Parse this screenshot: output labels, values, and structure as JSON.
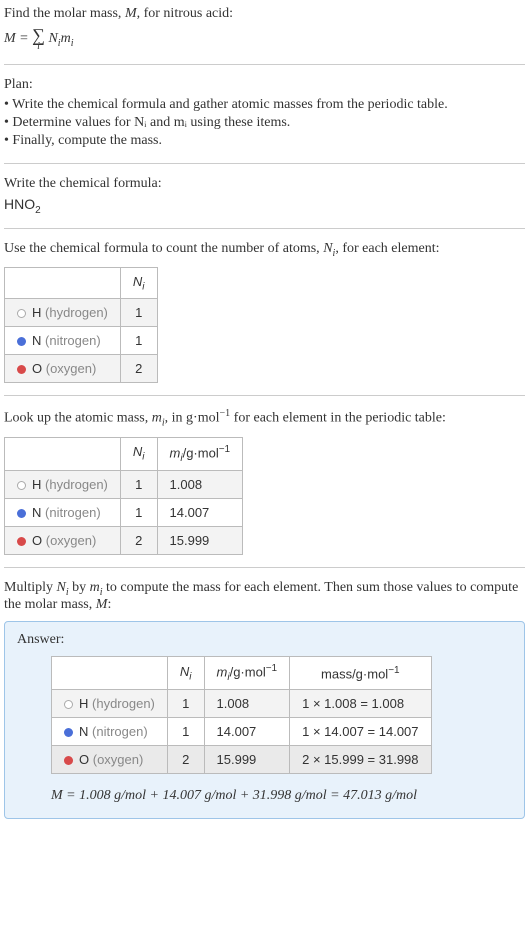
{
  "intro": {
    "line1": "Find the molar mass, ",
    "Mvar": "M",
    "line1b": ", for nitrous acid:",
    "eq_lhs": "M = ",
    "sigma": "∑",
    "sigma_under": "i",
    "eq_rhs": " N",
    "eq_i1": "i",
    "eq_m": "m",
    "eq_i2": "i"
  },
  "plan": {
    "title": "Plan:",
    "items": [
      "• Write the chemical formula and gather atomic masses from the periodic table.",
      "• Determine values for Nᵢ and mᵢ using these items.",
      "• Finally, compute the mass."
    ]
  },
  "writeFormula": {
    "title": "Write the chemical formula:",
    "formula_base": "HNO",
    "formula_sub": "2"
  },
  "countAtoms": {
    "title_a": "Use the chemical formula to count the number of atoms, ",
    "Nvar": "N",
    "Nsub": "i",
    "title_b": ", for each element:",
    "hdr_N": "N",
    "hdr_Nsub": "i",
    "rows": [
      {
        "dot": "dot-h",
        "sym": "H",
        "name": "(hydrogen)",
        "N": "1"
      },
      {
        "dot": "dot-n",
        "sym": "N",
        "name": "(nitrogen)",
        "N": "1"
      },
      {
        "dot": "dot-o",
        "sym": "O",
        "name": "(oxygen)",
        "N": "2"
      }
    ]
  },
  "lookup": {
    "title_a": "Look up the atomic mass, ",
    "mvar": "m",
    "msub": "i",
    "title_b": ", in g·mol",
    "title_sup": "−1",
    "title_c": " for each element in the periodic table:",
    "hdr_m": "m",
    "hdr_msub": "i",
    "hdr_unit": "/g·mol",
    "hdr_unit_sup": "−1",
    "rows": [
      {
        "dot": "dot-h",
        "sym": "H",
        "name": "(hydrogen)",
        "N": "1",
        "m": "1.008"
      },
      {
        "dot": "dot-n",
        "sym": "N",
        "name": "(nitrogen)",
        "N": "1",
        "m": "14.007"
      },
      {
        "dot": "dot-o",
        "sym": "O",
        "name": "(oxygen)",
        "N": "2",
        "m": "15.999"
      }
    ]
  },
  "multiply": {
    "title_a": "Multiply ",
    "N": "N",
    "Nsub": "i",
    "title_b": " by ",
    "m": "m",
    "msub": "i",
    "title_c": " to compute the mass for each element. Then sum those values to compute the molar mass, ",
    "Mvar": "M",
    "title_d": ":"
  },
  "answer": {
    "title": "Answer:",
    "hdr_mass": "mass/g·mol",
    "hdr_mass_sup": "−1",
    "rows": [
      {
        "dot": "dot-h",
        "sym": "H",
        "name": "(hydrogen)",
        "N": "1",
        "m": "1.008",
        "mass": "1 × 1.008 = 1.008"
      },
      {
        "dot": "dot-n",
        "sym": "N",
        "name": "(nitrogen)",
        "N": "1",
        "m": "14.007",
        "mass": "1 × 14.007 = 14.007"
      },
      {
        "dot": "dot-o",
        "sym": "O",
        "name": "(oxygen)",
        "N": "2",
        "m": "15.999",
        "mass": "2 × 15.999 = 31.998"
      }
    ],
    "final": "M = 1.008 g/mol + 14.007 g/mol + 31.998 g/mol = 47.013 g/mol"
  }
}
